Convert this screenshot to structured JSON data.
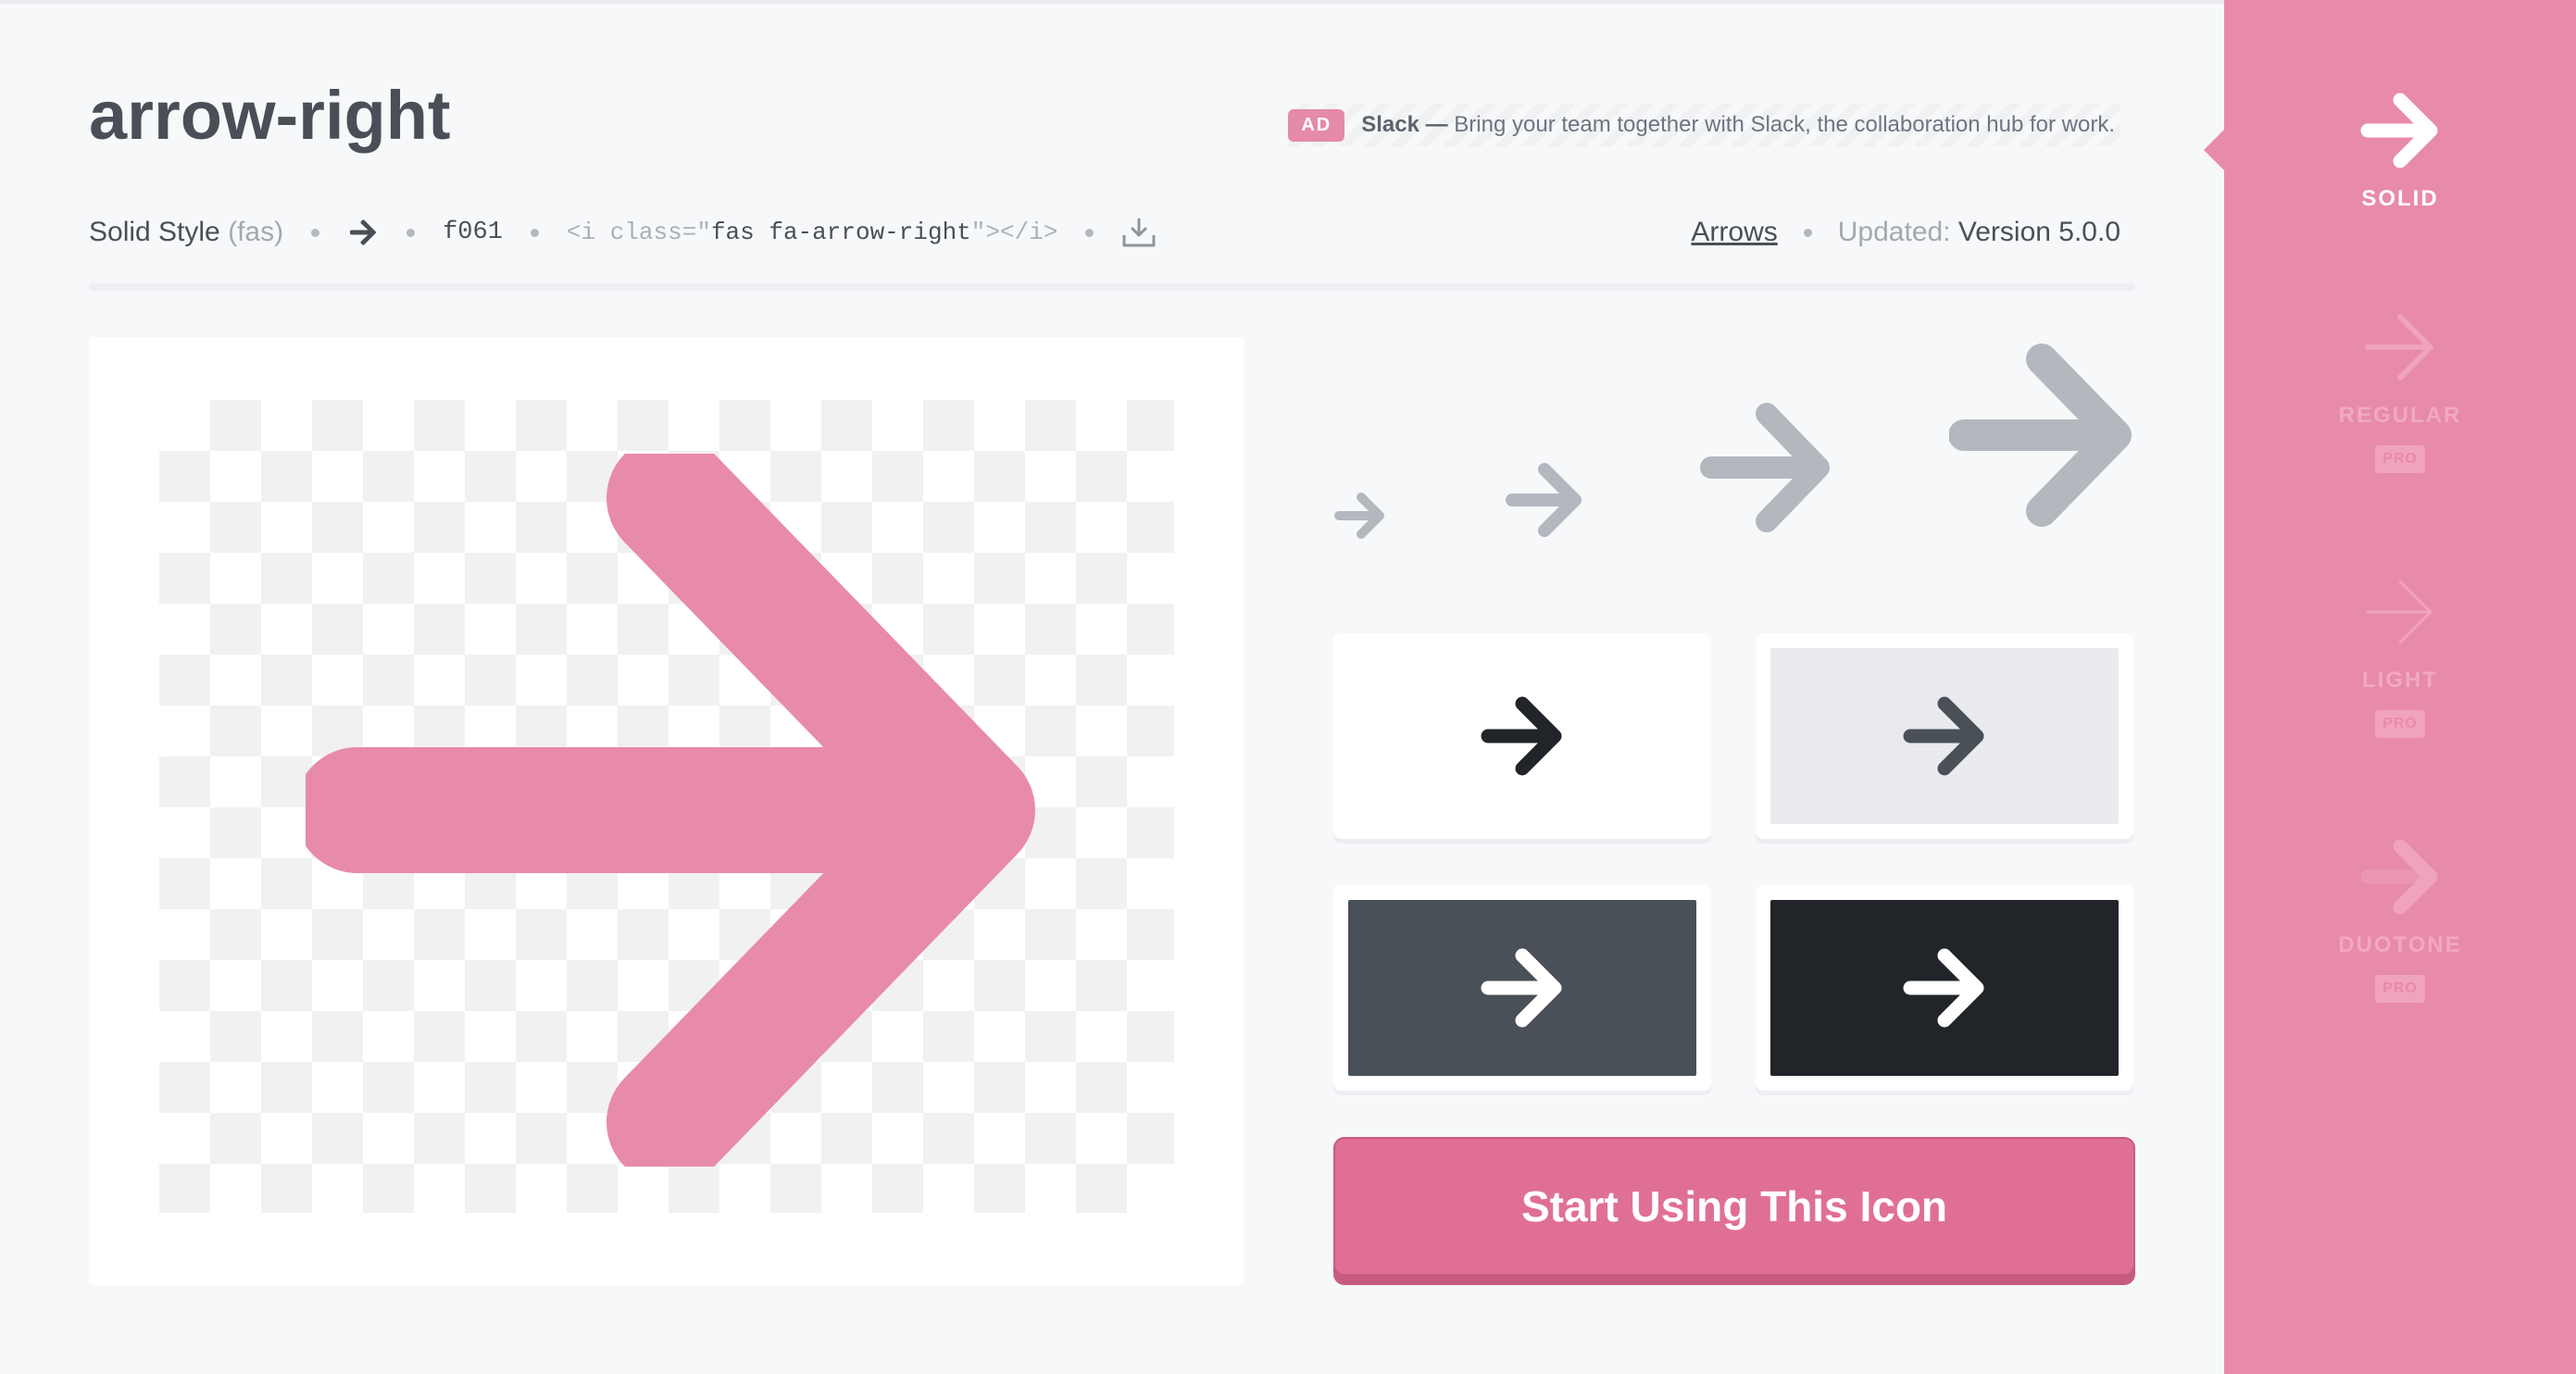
{
  "icon": {
    "name": "arrow-right",
    "style_label": "Solid Style",
    "style_prefix": "(fas)",
    "unicode": "f061",
    "snippet_open": "<i class=\"",
    "snippet_class": "fas fa-arrow-right",
    "snippet_close": "\"></i>",
    "category": "Arrows",
    "updated_label": "Updated:",
    "version": "Version 5.0.0"
  },
  "ad": {
    "tag": "AD",
    "brand": "Slack —",
    "text": "Bring your team together with Slack, the collaboration hub for work."
  },
  "cta": {
    "label": "Start Using This Icon"
  },
  "styles": [
    {
      "label": "SOLID",
      "active": true,
      "pro": ""
    },
    {
      "label": "REGULAR",
      "active": false,
      "pro": "PRO"
    },
    {
      "label": "LIGHT",
      "active": false,
      "pro": "PRO"
    },
    {
      "label": "DUOTONE",
      "active": false,
      "pro": "PRO"
    }
  ],
  "colors": {
    "accent": "#e88aab",
    "cta": "#e06f96",
    "size_preview": "#b3b8bf",
    "tile_light_bg": "#ffffff",
    "tile_gray_bg": "#e9eaed",
    "tile_slate_bg": "#495057",
    "tile_dark_bg": "#212529"
  },
  "icons": [
    "arrow-right-icon",
    "download-icon"
  ]
}
